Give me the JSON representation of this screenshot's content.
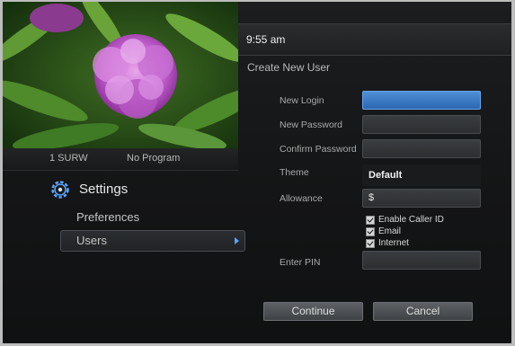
{
  "preview": {
    "channel_number": "1  SURW",
    "program": "No Program"
  },
  "settings": {
    "title": "Settings",
    "menu": [
      {
        "label": "Preferences",
        "selected": false
      },
      {
        "label": "Users",
        "selected": true
      }
    ]
  },
  "header": {
    "time": "9:55 am"
  },
  "form": {
    "title": "Create New User",
    "fields": {
      "login_label": "New Login",
      "login_value": "",
      "password_label": "New Password",
      "password_value": "",
      "confirm_label": "Confirm Password",
      "confirm_value": "",
      "theme_label": "Theme",
      "theme_value": "Default",
      "allowance_label": "Allowance",
      "allowance_value": "$",
      "pin_label": "Enter PIN",
      "pin_value": ""
    },
    "options": [
      {
        "label": "Enable Caller ID",
        "checked": true
      },
      {
        "label": "Email",
        "checked": true
      },
      {
        "label": "Internet",
        "checked": true
      }
    ],
    "continue_label": "Continue",
    "cancel_label": "Cancel"
  },
  "colors": {
    "accent": "#3a7cd0",
    "background": "#151617",
    "text": "#c6c6c6"
  }
}
